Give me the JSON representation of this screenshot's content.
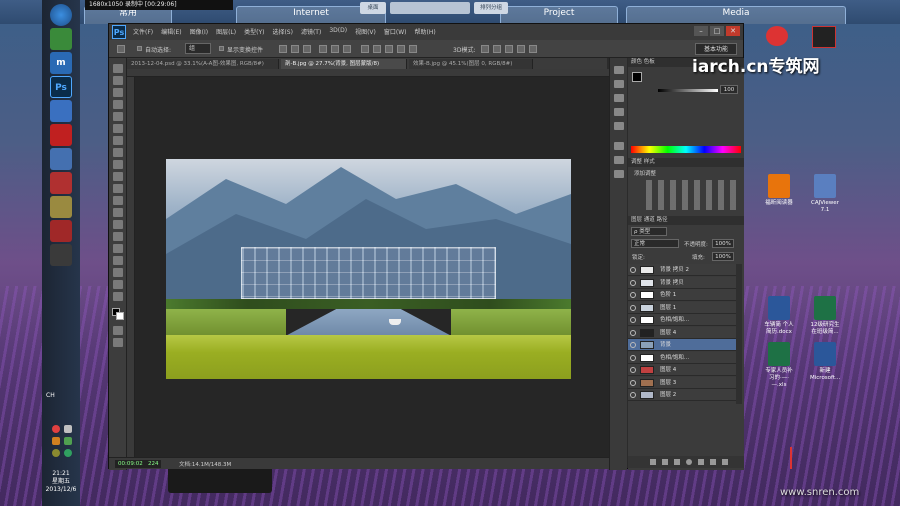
{
  "recorder": {
    "label": "1680x1050 录制中 [00:29:06]"
  },
  "fences": [
    {
      "title": "常用"
    },
    {
      "title": "Internet"
    },
    {
      "title": "Project"
    },
    {
      "title": "Media"
    }
  ],
  "fence_toolbar": {
    "left": "桌面",
    "right": "排列分组"
  },
  "taskbar": {
    "clock_time": "21:21",
    "clock_day": "星期五",
    "clock_date": "2013/12/6",
    "lang": "CH"
  },
  "desktop_icons": [
    {
      "label": "福昕阅读器",
      "color": "#e8740c"
    },
    {
      "label": "CAJViewer 7.1",
      "color": "#5a7fc0"
    },
    {
      "label": "车辆简 个人简历.docx",
      "color": "#2b579a"
    },
    {
      "label": "12级研究生在班级简...",
      "color": "#1e7145"
    },
    {
      "label": "专家人员补习的·—·—.xls",
      "color": "#1e7145"
    },
    {
      "label": "新建 Microsoft...",
      "color": "#2b579a"
    }
  ],
  "watermarks": {
    "main": "iarch.cn专筑网",
    "footer": "www.snren.com"
  },
  "photoshop": {
    "logo": "Ps",
    "menu": [
      "文件(F)",
      "编辑(E)",
      "图像(I)",
      "图层(L)",
      "类型(Y)",
      "选择(S)",
      "滤镜(T)",
      "3D(D)",
      "视图(V)",
      "窗口(W)",
      "帮助(H)"
    ],
    "window_buttons": [
      "–",
      "□",
      "✕"
    ],
    "options": {
      "auto_select_label": "自动选择:",
      "auto_select_value": "组",
      "transform_label": "显示变换控件",
      "workspace": "基本功能",
      "mode_3d": "3D模式:"
    },
    "tabs": [
      {
        "label": "2013-12-04.psd @ 33.1%(A-A图-效果图, RGB/8#)",
        "active": false
      },
      {
        "label": "剖-B.jpg @ 27.7%(背景, 图层蒙版/8)",
        "active": true
      },
      {
        "label": "效果-B.jpg @ 45.1%(图层 0, RGB/8#)",
        "active": false
      }
    ],
    "status": {
      "recording": "00:09:02",
      "count": "224",
      "doc": "文档:14.1M/148.3M"
    },
    "panels": {
      "color_tabs": "颜色  色板",
      "color_value": "100",
      "adjust_tabs": "调整  样式",
      "adjust_title": "添加调整",
      "layers_tabs": "图层  通道  路径",
      "kind_label": "ρ 类型",
      "blend_mode": "正常",
      "opacity_label": "不透明度:",
      "opacity_value": "100%",
      "lock_label": "锁定:",
      "fill_label": "填充:",
      "fill_value": "100%"
    },
    "layers": [
      {
        "name": "背景 拷贝 2",
        "selected": false,
        "thumb": "#e8e8e8"
      },
      {
        "name": "背景 拷贝",
        "selected": false,
        "thumb": "#e0e4ea"
      },
      {
        "name": "色阶 1",
        "selected": false,
        "thumb": "#ffffff"
      },
      {
        "name": "图层 1",
        "selected": false,
        "thumb": "#c9d2dc"
      },
      {
        "name": "色相/饱和...",
        "selected": false,
        "thumb": "#ffffff"
      },
      {
        "name": "图层 4",
        "selected": false,
        "thumb": "#222222"
      },
      {
        "name": "背景",
        "selected": true,
        "thumb": "#8aa0b8"
      },
      {
        "name": "色相/饱和...",
        "selected": false,
        "thumb": "#ffffff"
      },
      {
        "name": "图层 4",
        "selected": false,
        "thumb": "#c04040"
      },
      {
        "name": "图层 3",
        "selected": false,
        "thumb": "#a07050"
      },
      {
        "name": "图层 2",
        "selected": false,
        "thumb": "#b0b8c8"
      }
    ]
  }
}
